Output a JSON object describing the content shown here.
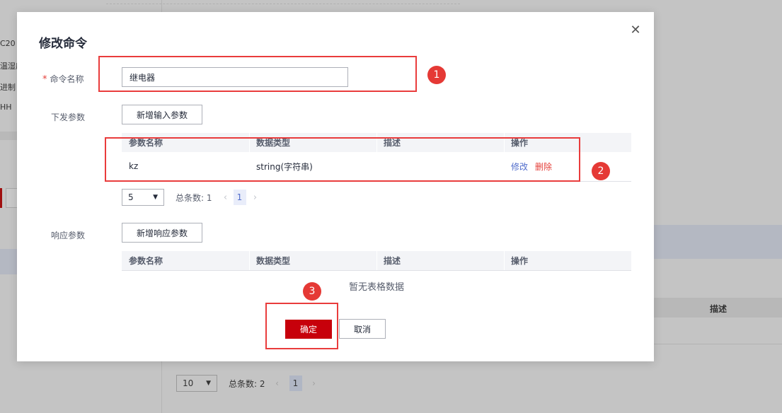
{
  "background": {
    "left_texts": [
      "C20",
      "温湿度",
      "进制",
      "HH"
    ],
    "table_header_desc": "描述",
    "pager": {
      "page_size": "10",
      "total": "总条数: 2",
      "page": "1"
    }
  },
  "modal": {
    "title": "修改命令",
    "command_name": {
      "label": "命令名称",
      "required_mark": "*",
      "value": "继电器"
    },
    "input_params": {
      "label": "下发参数",
      "add_button": "新增输入参数",
      "columns": [
        "参数名称",
        "数据类型",
        "描述",
        "操作"
      ],
      "rows": [
        {
          "name": "kz",
          "type": "string(字符串)",
          "desc": "",
          "edit": "修改",
          "delete": "删除"
        }
      ],
      "pager": {
        "page_size": "5",
        "total": "总条数: 1",
        "page": "1"
      }
    },
    "response_params": {
      "label": "响应参数",
      "add_button": "新增响应参数",
      "columns": [
        "参数名称",
        "数据类型",
        "描述",
        "操作"
      ],
      "empty_text": "暂无表格数据"
    },
    "confirm_label": "确定",
    "cancel_label": "取消"
  },
  "annotations": [
    "1",
    "2",
    "3"
  ],
  "colors": {
    "primary": "#c7000b",
    "link": "#526ecc",
    "danger": "#e5403a",
    "annotation": "#e53935"
  }
}
